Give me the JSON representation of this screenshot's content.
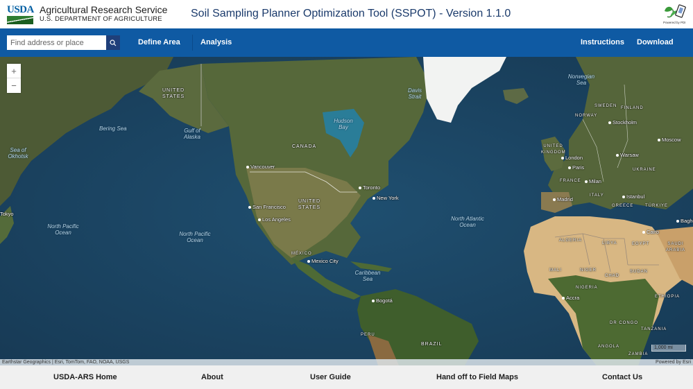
{
  "header": {
    "logo_text": "USDA",
    "agency_name": "Agricultural Research Service",
    "department": "U.S. DEPARTMENT OF AGRICULTURE",
    "app_title": "Soil Sampling Planner Optimization Tool (SSPOT) - Version 1.1.0",
    "partner_caption": "Powered by PDI"
  },
  "navbar": {
    "search": {
      "placeholder": "Find address or place",
      "value": "",
      "icon": "search-icon"
    },
    "left_links": [
      "Define Area",
      "Analysis"
    ],
    "right_links": [
      "Instructions",
      "Download"
    ]
  },
  "map": {
    "zoom_in": "+",
    "zoom_out": "−",
    "basemap": "World Imagery (satellite)",
    "labels": {
      "countries": [
        "UNITED STATES",
        "CANADA",
        "UNITED STATES",
        "MÉXICO",
        "BRAZIL",
        "PERU",
        "SWEDEN",
        "FINLAND",
        "NORWAY",
        "UNITED KINGDOM",
        "FRANCE",
        "ITALY",
        "UKRAINE",
        "GREECE",
        "TÜRKIYE",
        "ALGERIA",
        "LIBYA",
        "EGYPT",
        "SAUDI ARABIA",
        "MALI",
        "NIGER",
        "CHAD",
        "SUDAN",
        "NIGERIA",
        "ETHIOPIA",
        "DR CONGO",
        "TANZANIA",
        "ANGOLA",
        "ZAMBIA"
      ],
      "cities": [
        "Vancouver",
        "Toronto",
        "New York",
        "San Francisco",
        "Los Angeles",
        "Mexico City",
        "Bogotá",
        "Tokyo",
        "Stockholm",
        "Moscow",
        "London",
        "Paris",
        "Warsaw",
        "Milan",
        "Madrid",
        "Istanbul",
        "Cairo",
        "Accra",
        "Baghdad"
      ],
      "waters": [
        "Bering Sea",
        "Gulf of Alaska",
        "Sea of Okhotsk",
        "Hudson Bay",
        "Davis Strait",
        "Norwegian Sea",
        "North Pacific Ocean",
        "North Pacific Ocean",
        "North Atlantic Ocean",
        "Caribbean Sea"
      ]
    },
    "scale": "1,000 mi",
    "attribution": "Earthstar Geographics | Esri, TomTom, FAO, NOAA, USGS",
    "powered_by": "Powered by Esri"
  },
  "footer": {
    "links": [
      "USDA-ARS Home",
      "About",
      "User Guide",
      "Hand off to Field Maps",
      "Contact Us"
    ]
  },
  "colors": {
    "navbar": "#0f5aa3",
    "search_button": "#1f3f7a",
    "title": "#1a3a6b",
    "footer_bg": "#f0f0f0"
  }
}
